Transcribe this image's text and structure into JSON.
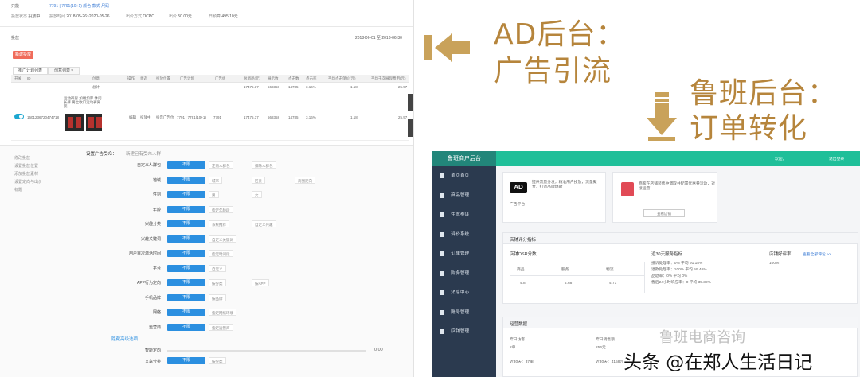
{
  "ad_panel": {
    "summary": {
      "item_label": "只能",
      "status_label": "投放状态",
      "status": "投放中",
      "period_label": "投放时间",
      "period": "2018-05-26~2020-05-26",
      "bid_label": "出价方式",
      "bid_type": "OCPC",
      "budget_label": "出价",
      "budget": "50.00元",
      "daily_label": "日预算",
      "daily": "495.10元",
      "product_line": "7791 | 7791(10+1) 颜色 款式 尺码"
    },
    "section_label": "投放",
    "date_range": "2018-06-01 至 2018-06-30",
    "new_button": "新建投放",
    "tabs": [
      "推广计划列表",
      "创意列表 ▾"
    ],
    "columns": [
      "开关",
      "ID",
      "创意",
      "操作",
      "状态",
      "投放位置",
      "广告计划",
      "广告组",
      "总消耗(元)",
      "展示数",
      "点击数",
      "点击率",
      "平均点击单价(元)",
      "平均千次展现费用(元)"
    ],
    "total_row": {
      "label": "总计",
      "cost": "17475.37",
      "shows": "568358",
      "clicks": "14785",
      "ctr": "3.16%",
      "cpc": "1.18",
      "cpm": "25.97"
    },
    "product_row": {
      "id": "1601236720474718",
      "title": "运动裤男 加绒加厚 休闲长裤 男士收口运动裤男装",
      "action": "编辑",
      "status": "投放中",
      "placement": "抖音广告位",
      "plan": "7791 | 7791(10+1)",
      "group": "7791",
      "cost": "17475.37",
      "shows": "568358",
      "clicks": "14785",
      "ctr": "3.16%",
      "cpc": "1.18",
      "cpm": "25.97"
    },
    "side_nav": [
      "修改投放",
      "设置投放位置",
      "添加投放素材",
      "设置定向与出价",
      "标题"
    ],
    "setting_title": "设置广告受众：",
    "setting_hint": "新建已有受众人群",
    "targeting": [
      {
        "label": "自定义人群包",
        "opts": [
          "不限",
          "定向人群包",
          "排除人群包"
        ]
      },
      {
        "label": "地域",
        "opts": [
          "不限",
          "城市",
          "区县",
          "商圈定向"
        ]
      },
      {
        "label": "性别",
        "opts": [
          "不限",
          "男",
          "女"
        ]
      },
      {
        "label": "年龄",
        "opts": [
          "不限",
          "指定年龄段"
        ]
      },
      {
        "label": "兴趣分类",
        "opts": [
          "不限",
          "系统推荐",
          "自定义兴趣"
        ]
      },
      {
        "label": "兴趣关键词",
        "opts": [
          "不限",
          "自定义关键词"
        ]
      },
      {
        "label": "用户首次激活时间",
        "opts": [
          "不限",
          "指定时间段"
        ]
      },
      {
        "label": "平台",
        "opts": [
          "不限",
          "自定义"
        ]
      },
      {
        "label": "APP行为定向",
        "opts": [
          "不限",
          "按分类",
          "按APP"
        ]
      },
      {
        "label": "手机品牌",
        "opts": [
          "不限",
          "按品牌"
        ]
      },
      {
        "label": "网络",
        "opts": [
          "不限",
          "指定网络环境"
        ]
      },
      {
        "label": "运营商",
        "opts": [
          "不限",
          "指定运营商"
        ]
      }
    ],
    "hidden_section": "隐藏高级选项",
    "smart_label": "智能定向",
    "smart_value": "0.00",
    "article_label": "文章分类",
    "article_opts": [
      "不限",
      "按分类"
    ]
  },
  "titles": {
    "ad_line1": "AD后台：",
    "ad_line2": "广告引流",
    "luban_line1": "鲁班后台：",
    "luban_line2": "订单转化"
  },
  "luban": {
    "brand": "鲁班商户后台",
    "account": "欢迎，",
    "logout": "退出登录",
    "nav": [
      "首页首页",
      "商品管理",
      "生意参谋",
      "评价系统",
      "订单管理",
      "财务管理",
      "消息中心",
      "账号管理",
      "店铺管理"
    ],
    "ad_card_title": "AD",
    "ad_card_text": "提供流量分发，精准用户投放，流量聚合，打造品牌爆款",
    "ad_card_sub": "广告平台",
    "qz_card_text": "商家在店铺装修中调取并配置优惠券活动，对接运营",
    "qz_card_btn": "查看店铺",
    "metrics_title": "店铺评分指标",
    "score_title": "店铺DSR分数",
    "score_cols": [
      "商品",
      "服务",
      "物流"
    ],
    "score_vals": [
      "4.8",
      "4.68",
      "4.71"
    ],
    "rate_title": "近30天服务指标",
    "rate_lines": [
      "投诉处理率：0% 平均 91.15%",
      "退款处理率：100% 平均 59.46%",
      "品退率：0% 平均 0%",
      "售后24小时响应率：0 平均 35.39%"
    ],
    "good_title": "店铺好评率",
    "good_link": "查看全部评论 >>",
    "good_val": "100%",
    "ops_title": "经营数据",
    "ops_items": [
      {
        "label": "昨日访客",
        "val": "2单"
      },
      {
        "label": "昨日销售额",
        "val": "256元"
      },
      {
        "label": "近30天：",
        "val": "37单"
      },
      {
        "label": "近30天：",
        "val": "4158元"
      }
    ]
  },
  "watermarks": {
    "wm1": "鲁班电商咨询",
    "wm2": "头条 @在郑人生活日记"
  },
  "colors": {
    "gold": "#b6853c",
    "teal": "#1fbf99",
    "blue_btn": "#2b8fe0",
    "red_btn": "#f06c5b"
  }
}
